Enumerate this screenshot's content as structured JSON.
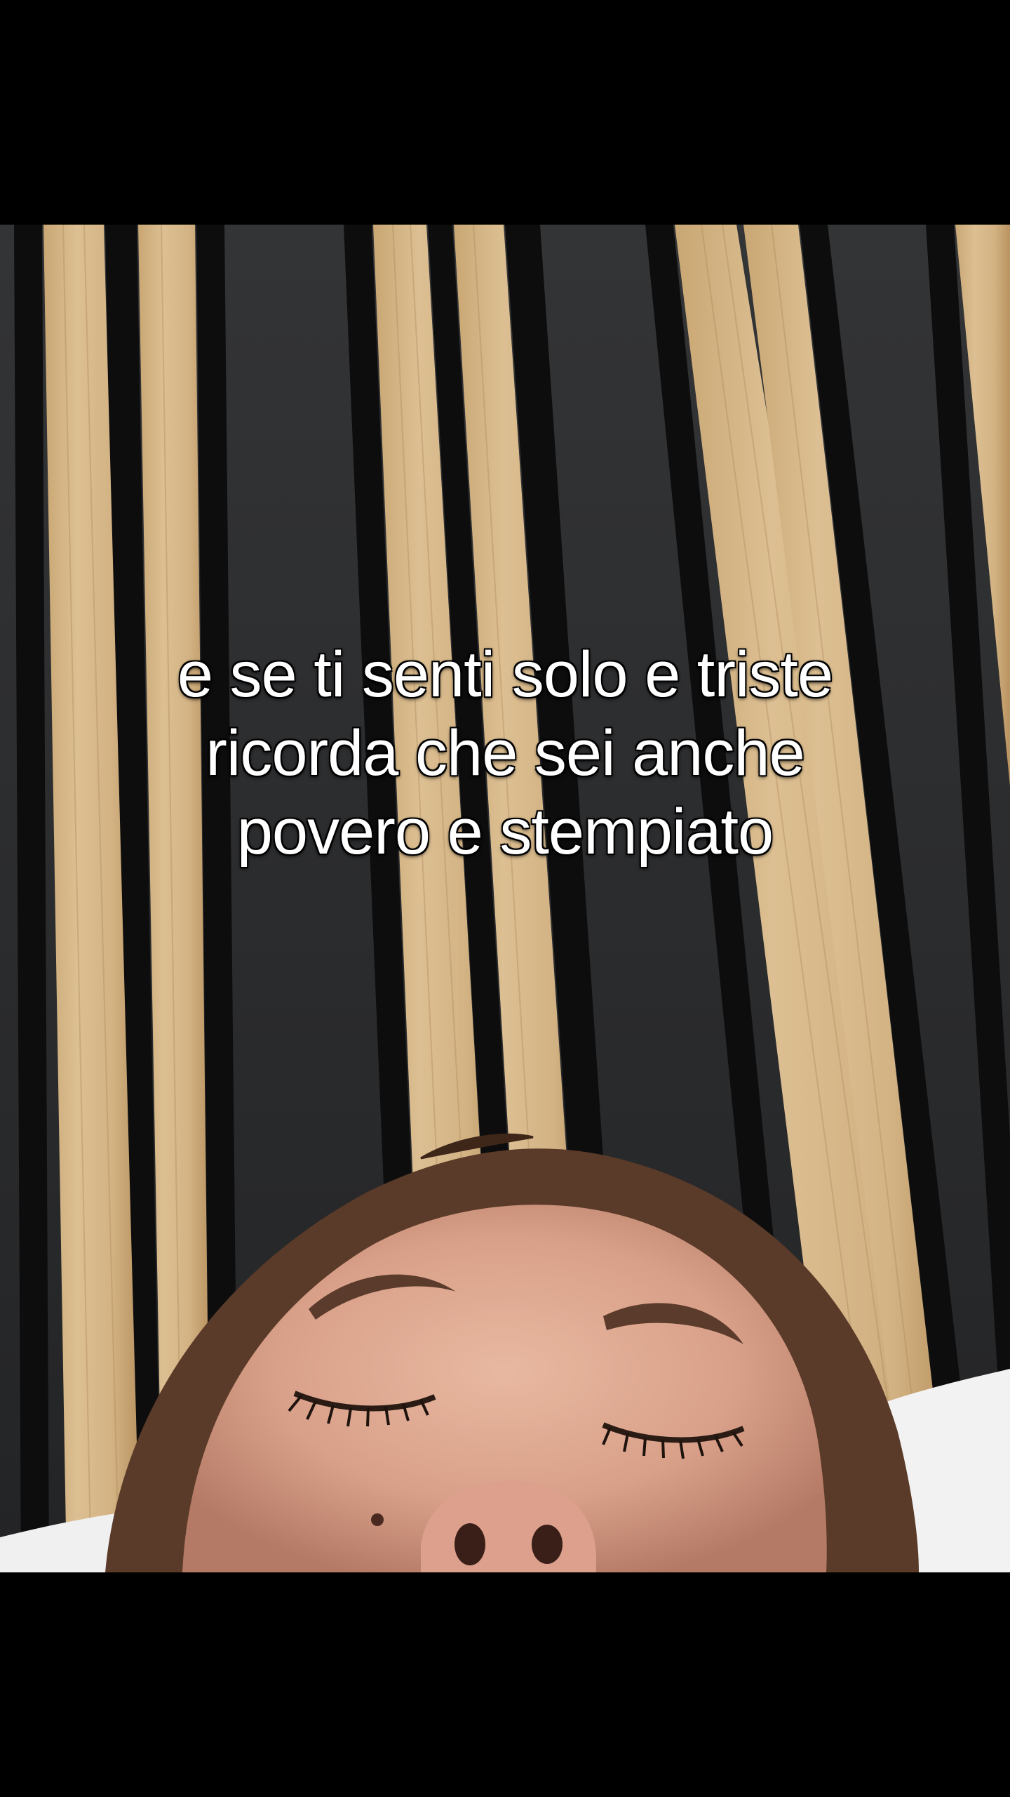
{
  "video": {
    "caption_lines": [
      "e se ti senti solo e triste",
      "ricorda che sei anche",
      "povero e stempiato"
    ]
  },
  "colors": {
    "wall_dark": "#2b2c2e",
    "slat_gap": "#0d0d0e",
    "wood_light": "#d8b98a",
    "wood_dark": "#b8935f",
    "skin": "#d8a08a",
    "hair": "#5a3a28",
    "pillow": "#f2f2f2",
    "caption_text": "#ffffff"
  }
}
